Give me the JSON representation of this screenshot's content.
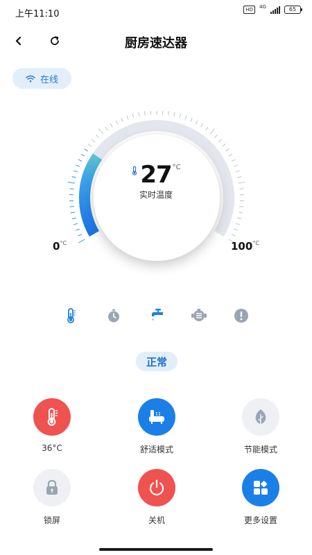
{
  "status_bar": {
    "time": "上午11:10",
    "hd": "HD",
    "network": "4G",
    "battery": "65"
  },
  "header": {
    "title": "厨房速达器"
  },
  "connection": {
    "status": "在线"
  },
  "gauge": {
    "current_temp": "27",
    "unit": "°C",
    "caption": "实时温度",
    "min": "0",
    "max": "100",
    "level_fraction": 0.27,
    "colors": {
      "track": "#e4e6ed",
      "fill_start": "#1a73e8",
      "fill_end": "#5cc2d0",
      "tick": "#b9c4d2",
      "tick_active": "#2f8fe6"
    }
  },
  "status_icons": [
    "thermometer-icon",
    "timer-icon",
    "faucet-icon",
    "pump-icon",
    "alert-icon"
  ],
  "state": {
    "label": "正常"
  },
  "controls": [
    {
      "label": "36°C",
      "icon": "thermometer-icon",
      "bg": "#f0524f"
    },
    {
      "label": "舒适模式",
      "icon": "bathtub-icon",
      "bg": "#1b7fe8"
    },
    {
      "label": "节能模式",
      "icon": "leaf-icon",
      "bg": "#eef0f4"
    },
    {
      "label": "锁屏",
      "icon": "lock-icon",
      "bg": "#eef0f4"
    },
    {
      "label": "关机",
      "icon": "power-icon",
      "bg": "#f0524f"
    },
    {
      "label": "更多设置",
      "icon": "apps-icon",
      "bg": "#1b7fe8"
    }
  ]
}
